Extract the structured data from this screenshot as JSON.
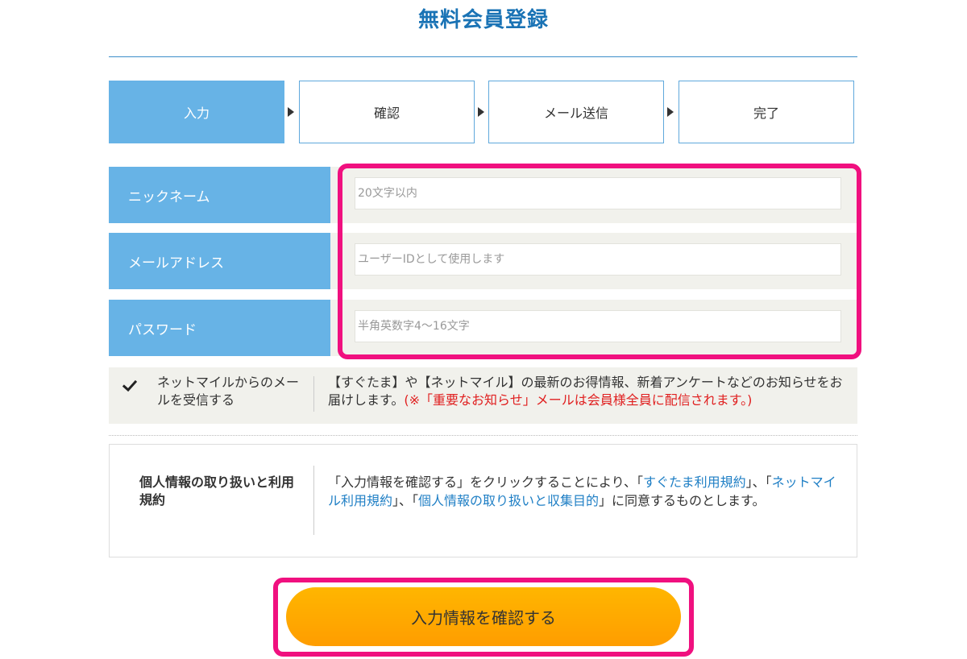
{
  "page": {
    "title": "無料会員登録"
  },
  "steps": [
    {
      "label": "入力",
      "active": true
    },
    {
      "label": "確認",
      "active": false
    },
    {
      "label": "メール送信",
      "active": false
    },
    {
      "label": "完了",
      "active": false
    }
  ],
  "form": {
    "nickname": {
      "label": "ニックネーム",
      "placeholder": "20文字以内",
      "value": ""
    },
    "email": {
      "label": "メールアドレス",
      "placeholder": "ユーザーIDとして使用します",
      "value": ""
    },
    "password": {
      "label": "パスワード",
      "placeholder": "半角英数字4〜16文字",
      "value": ""
    }
  },
  "consent": {
    "checked": true,
    "label": "ネットマイルからのメールを受信する",
    "text": "【すぐたま】や【ネットマイル】の最新のお得情報、新着アンケートなどのお知らせをお届けします。",
    "note": "(※「重要なお知らせ」メールは会員様全員に配信されます。)"
  },
  "privacy": {
    "heading": "個人情報の取り扱いと利用規約",
    "text_before": "「入力情報を確認する」をクリックすることにより、「",
    "link1": "すぐたま利用規約",
    "text_mid1": "」、「",
    "link2": "ネットマイル利用規約",
    "text_mid2": "」、「",
    "link3": "個人情報の取り扱いと収集目的",
    "text_after": "」に同意するものとします。"
  },
  "submit": {
    "label": "入力情報を確認する"
  },
  "colors": {
    "accent": "#67b3e6",
    "title": "#1a73b5",
    "highlight": "#f0107f",
    "button": "#ffa800",
    "warning": "#e02020",
    "link": "#1f7fc5"
  }
}
